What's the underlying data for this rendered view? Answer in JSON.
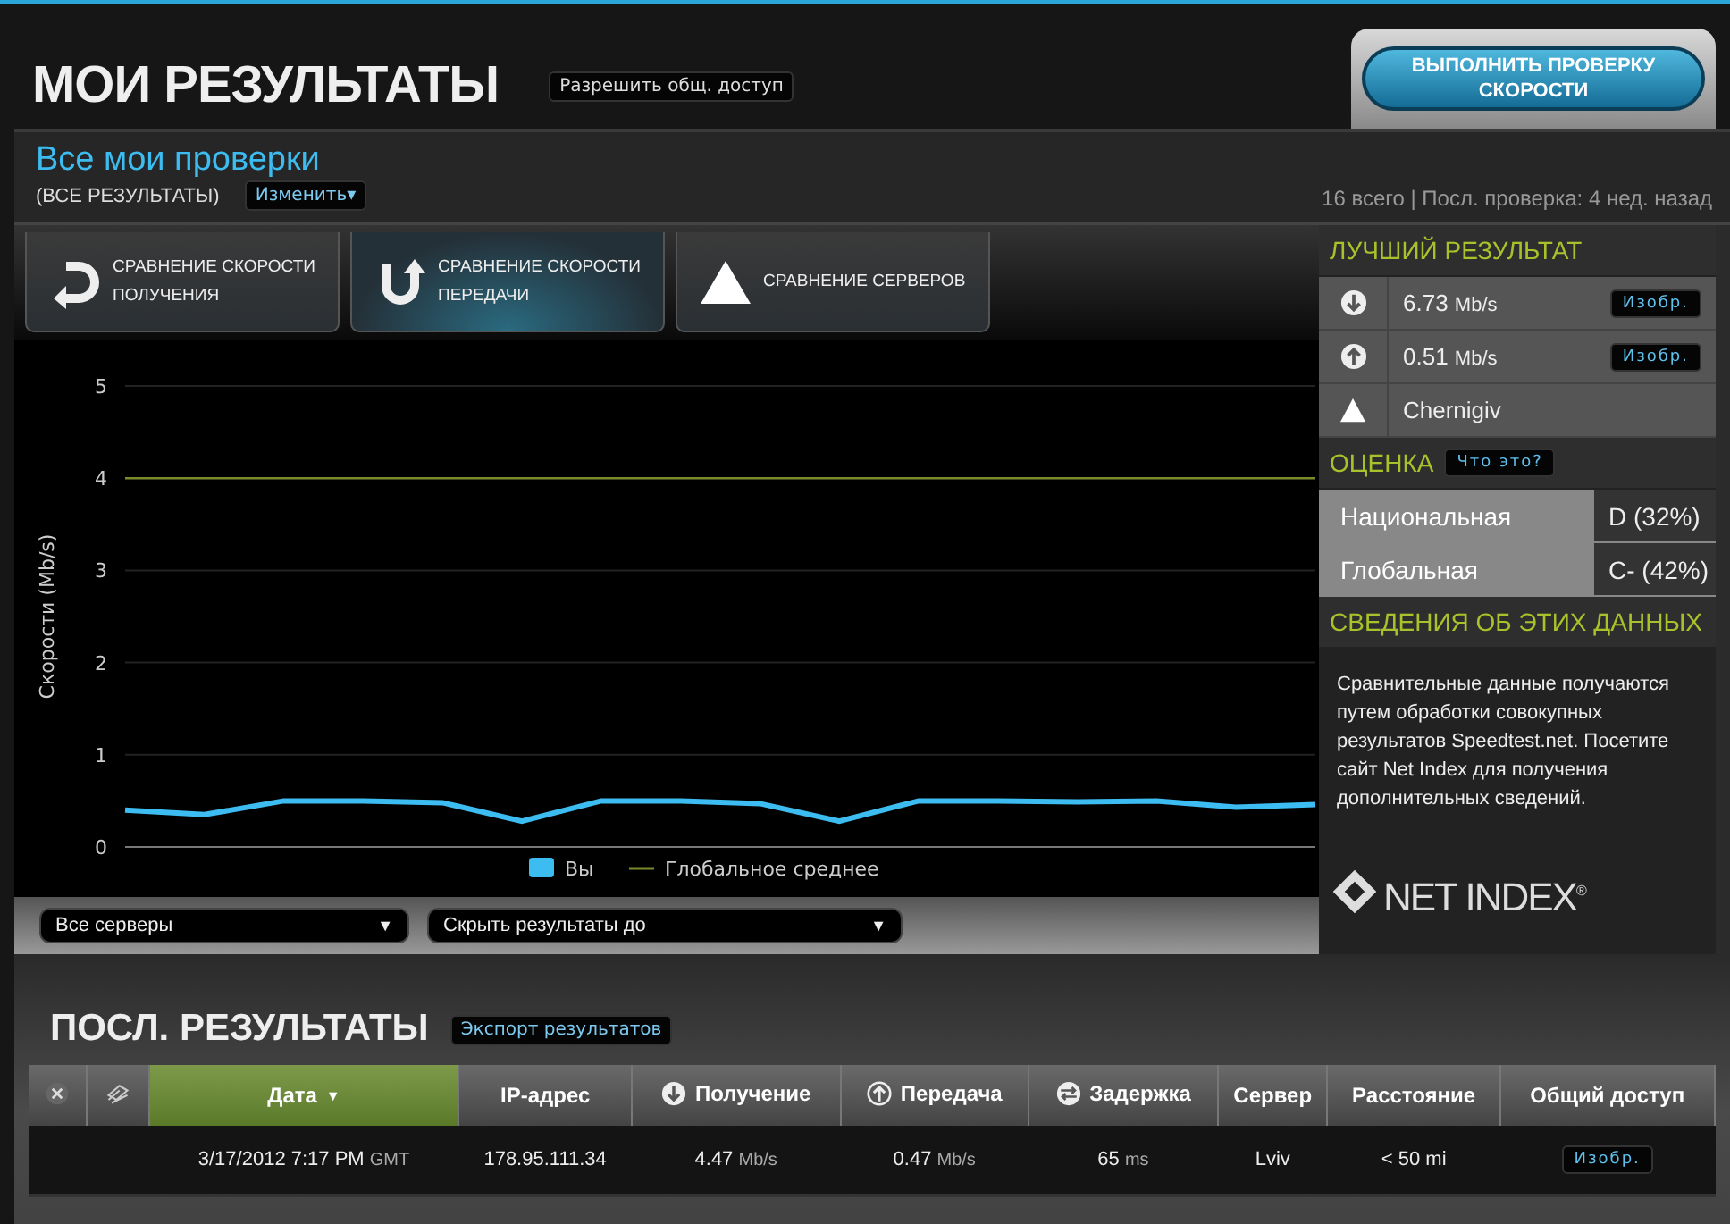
{
  "header": {
    "title": "МОИ РЕЗУЛЬТАТЫ",
    "share_button": "Разрешить общ. доступ",
    "run_button": "ВЫПОЛНИТЬ ПРОВЕРКУ СКОРОСТИ"
  },
  "summary": {
    "title": "Все мои проверки",
    "subtitle": "(ВСЕ РЕЗУЛЬТАТЫ)",
    "change_button": "Изменить",
    "change_caret": "▾",
    "stats": "16 всего | Посл. проверка: 4 нед. назад"
  },
  "tabs": [
    {
      "kind": "download",
      "label": "СРАВНЕНИЕ СКОРОСТИ ПОЛУЧЕНИЯ",
      "selected": false
    },
    {
      "kind": "upload",
      "label": "СРАВНЕНИЕ СКОРОСТИ ПЕРЕДАЧИ",
      "selected": true
    },
    {
      "kind": "server",
      "label": "СРАВНЕНИЕ СЕРВЕРОВ",
      "selected": false
    }
  ],
  "chart": {
    "chart_data": {
      "type": "line",
      "ylabel": "Скорости (Mb/s)",
      "grid": true,
      "legend": true,
      "ylim": [
        0,
        5
      ],
      "yticks": [
        0,
        1,
        2,
        3,
        4,
        5
      ],
      "series": [
        {
          "name": "Вы",
          "color": "#3cbcf0",
          "values": [
            0.4,
            0.35,
            0.5,
            0.5,
            0.48,
            0.28,
            0.5,
            0.5,
            0.47,
            0.28,
            0.5,
            0.5,
            0.49,
            0.5,
            0.43,
            0.46
          ]
        },
        {
          "name": "Глобальное среднее",
          "color": "#7a8a2a",
          "values": [
            4,
            4,
            4,
            4,
            4,
            4,
            4,
            4,
            4,
            4,
            4,
            4,
            4,
            4,
            4,
            4
          ]
        }
      ]
    }
  },
  "filters": [
    {
      "label": "Все серверы",
      "caret": "▼"
    },
    {
      "label": "Скрыть результаты до",
      "caret": "▼"
    }
  ],
  "sidebar": {
    "best_title": "ЛУЧШИЙ РЕЗУЛЬТАТ",
    "best": [
      {
        "kind": "download",
        "value": "6.73",
        "unit": "Mb/s",
        "button": "Изобр."
      },
      {
        "kind": "upload",
        "value": "0.51",
        "unit": "Mb/s",
        "button": "Изобр."
      },
      {
        "kind": "server",
        "value": "Chernigiv"
      }
    ],
    "grade_title": "ОЦЕНКА",
    "grade_help": "Что это?",
    "grades": [
      {
        "label": "Национальная",
        "value": "D (32%)"
      },
      {
        "label": "Глобальная",
        "value": "C- (42%)"
      }
    ],
    "info_title": "СВЕДЕНИЯ ОБ ЭТИХ ДАННЫХ",
    "info_text": "Сравнительные данные получаются путем обработки совокупных результатов Speedtest.net. Посетите сайт Net Index для получения дополнительных сведений.",
    "logo": "NET INDEX",
    "logo_mark": "®"
  },
  "recent": {
    "title": "ПОСЛ. РЕЗУЛЬТАТЫ",
    "export_button": "Экспорт результатов",
    "columns": [
      {
        "kind": "close",
        "selected": false
      },
      {
        "kind": "stack",
        "selected": false
      },
      {
        "label": "Дата",
        "sort_mark": "▼",
        "selected": true
      },
      {
        "label": "IP-адрес",
        "selected": false
      },
      {
        "kind": "download",
        "label": "Получение",
        "selected": false
      },
      {
        "kind": "upload",
        "label": "Передача",
        "selected": false
      },
      {
        "kind": "ping",
        "label": "Задержка",
        "selected": false
      },
      {
        "label": "Сервер",
        "selected": false
      },
      {
        "label": "Расстояние",
        "selected": false
      },
      {
        "label": "Общий доступ",
        "selected": false
      }
    ],
    "rows": [
      {
        "date": "3/17/2012 7:17 PM",
        "tz": "GMT",
        "ip": "178.95.111.34",
        "download": "4.47",
        "download_unit": "Mb/s",
        "upload": "0.47",
        "upload_unit": "Mb/s",
        "ping": "65",
        "ping_unit": "ms",
        "server": "Lviv",
        "distance": "< 50 mi",
        "share": "Изобр."
      }
    ]
  }
}
